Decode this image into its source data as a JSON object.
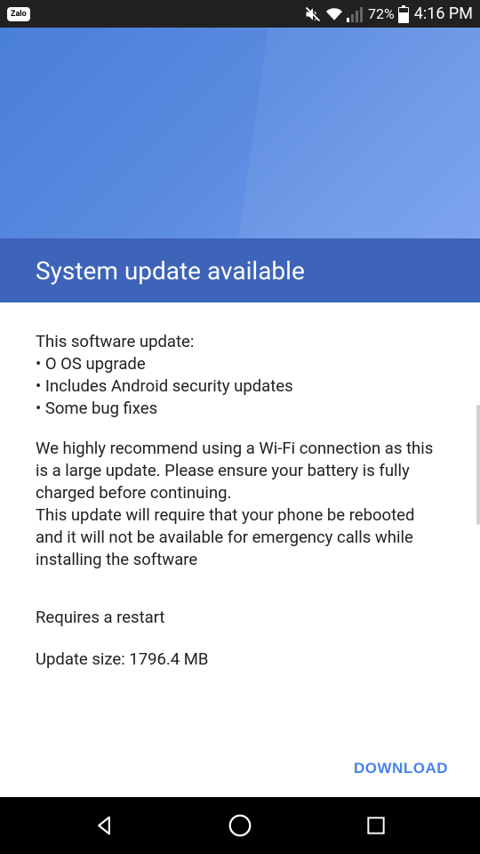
{
  "status_bar": {
    "app_badge": "Zalo",
    "battery_pct": "72%",
    "time": "4:16 PM"
  },
  "header": {
    "title": "System update available"
  },
  "content": {
    "intro": "This software update:",
    "bullet1": "• O OS upgrade",
    "bullet2": "• Includes Android security updates",
    "bullet3": "• Some bug fixes",
    "recommend": "We highly recommend using a Wi-Fi connection as this is a large update. Please ensure your battery is fully charged before continuing.",
    "reboot": "This update will require that your phone be rebooted and it will not be available for emergency calls while installing the software",
    "restart": "Requires a restart",
    "size": "Update size: 1796.4 MB"
  },
  "actions": {
    "download": "DOWNLOAD"
  }
}
